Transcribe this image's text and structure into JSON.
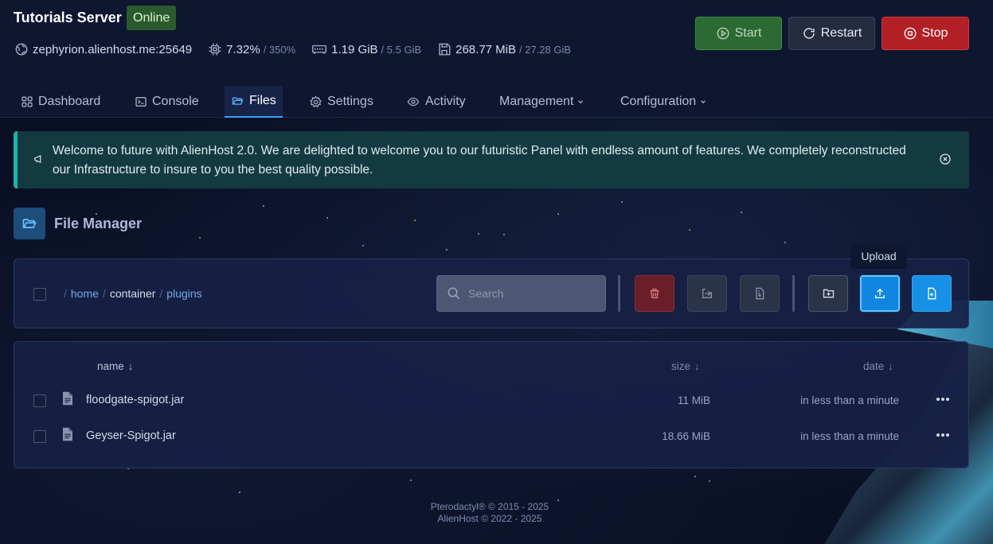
{
  "server": {
    "title": "Tutorials Server",
    "status": "Online",
    "address": "zephyrion.alienhost.me:25649",
    "cpu": "7.32%",
    "cpu_limit": "/ 350%",
    "memory": "1.19 GiB",
    "memory_limit": "/ 5.5 GiB",
    "disk": "268.77 MiB",
    "disk_limit": "/ 27.28 GiB"
  },
  "power": {
    "start": "Start",
    "restart": "Restart",
    "stop": "Stop"
  },
  "tabs": [
    {
      "label": "Dashboard"
    },
    {
      "label": "Console"
    },
    {
      "label": "Files"
    },
    {
      "label": "Settings"
    },
    {
      "label": "Activity"
    },
    {
      "label": "Management"
    },
    {
      "label": "Configuration"
    }
  ],
  "announcement": {
    "text": "Welcome to future with AlienHost 2.0. We are delighted to welcome you to our futuristic Panel with endless amount of features. We completely reconstructed our Infrastructure to insure to you the best quality possible."
  },
  "file_manager": {
    "title": "File Manager",
    "breadcrumb": [
      "home",
      "container",
      "plugins"
    ],
    "search_placeholder": "Search",
    "tooltip": "Upload",
    "columns": {
      "name": "name",
      "size": "size",
      "date": "date"
    },
    "files": [
      {
        "name": "floodgate-spigot.jar",
        "size": "11 MiB",
        "date": "in less than a minute"
      },
      {
        "name": "Geyser-Spigot.jar",
        "size": "18.66 MiB",
        "date": "in less than a minute"
      }
    ]
  },
  "footer": {
    "line1": "Pterodactyl® © 2015 - 2025",
    "line2": "AlienHost © 2022 - 2025"
  },
  "colors": {
    "accent": "#1186e0",
    "online": "#2c5a2e",
    "stop": "#b21f24",
    "start": "#2b6a32"
  }
}
